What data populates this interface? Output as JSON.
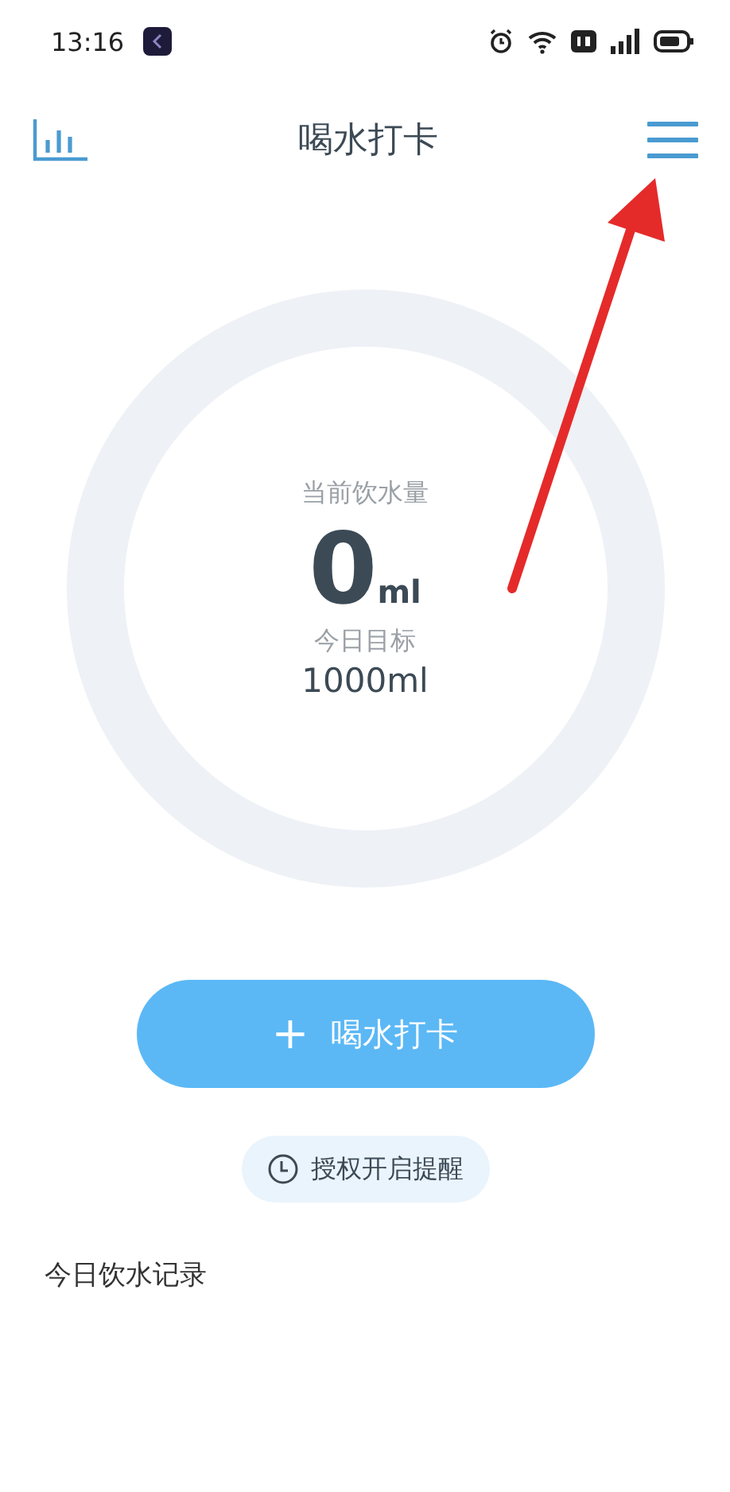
{
  "status_bar": {
    "time": "13:16"
  },
  "header": {
    "title": "喝水打卡"
  },
  "progress": {
    "label": "当前饮水量",
    "amount": "0",
    "unit": "ml",
    "goal_label": "今日目标",
    "goal": "1000ml"
  },
  "checkin_button": {
    "icon": "+",
    "label": "喝水打卡"
  },
  "reminder_button": {
    "label": "授权开启提醒"
  },
  "records": {
    "title": "今日饮水记录"
  }
}
